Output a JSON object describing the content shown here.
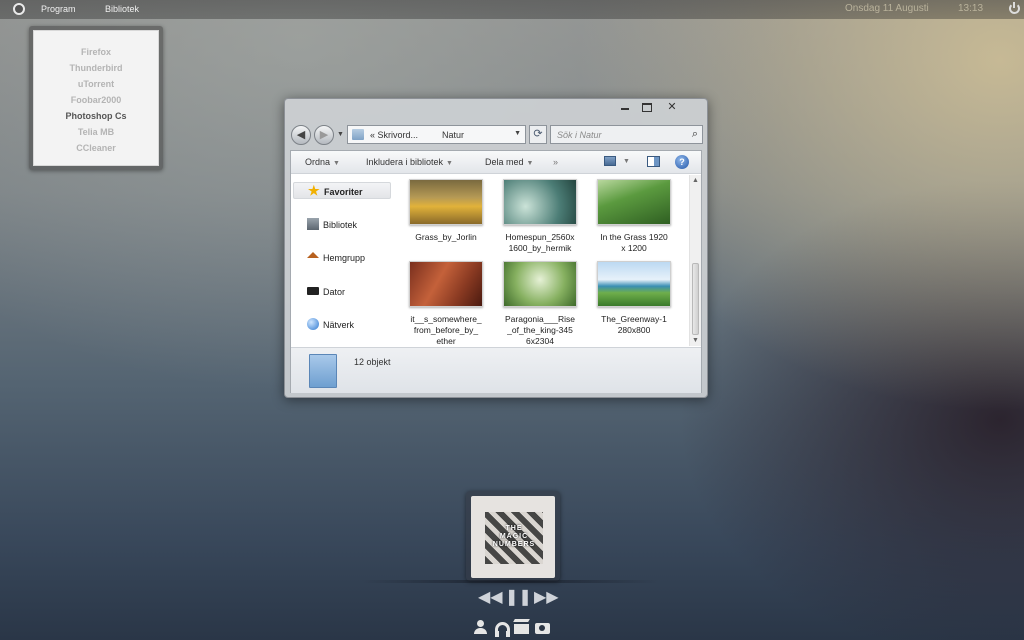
{
  "topbar": {
    "menu": [
      "Program",
      "Bibliotek"
    ],
    "date": "Onsdag 11 Augusti",
    "time": "13:13"
  },
  "launcher": {
    "items": [
      "Firefox",
      "Thunderbird",
      "uTorrent",
      "Foobar2000",
      "Photoshop Cs",
      "Telia MB",
      "CCleaner"
    ],
    "active_item": "Photoshop Cs"
  },
  "explorer": {
    "caption_buttons": {
      "minimize": "minimize-icon",
      "maximize": "maximize-icon",
      "close": "✕"
    },
    "address": {
      "crumbs": [
        "« Skrivord...",
        "Natur"
      ]
    },
    "search": {
      "placeholder": "Sök i Natur"
    },
    "commands": [
      "Ordna",
      "Inkludera i bibliotek",
      "Dela med",
      "»"
    ],
    "nav_pane": [
      {
        "label": "Favoriter",
        "icon": "star-icon"
      },
      {
        "label": "Bibliotek",
        "icon": "library-icon"
      },
      {
        "label": "Hemgrupp",
        "icon": "homegroup-icon"
      },
      {
        "label": "Dator",
        "icon": "computer-icon"
      },
      {
        "label": "Nätverk",
        "icon": "network-icon"
      }
    ],
    "files": [
      {
        "name": "Grass_by_Jorlin"
      },
      {
        "name": "Homespun_2560x\n1600_by_hermik"
      },
      {
        "name": "In the Grass 1920\nx 1200"
      },
      {
        "name": "it__s_somewhere_\nfrom_before_by_\nether"
      },
      {
        "name": "Paragonia___Rise\n_of_the_king-345\n6x2304"
      },
      {
        "name": "The_Greenway-1\n280x800"
      }
    ],
    "status": "12 objekt"
  },
  "player": {
    "album_art_text": "THE\nMAGIC\nNUMBERS",
    "controls": {
      "prev": "◀◀",
      "pause": "❚❚",
      "next": "▶▶"
    },
    "dock_icons": [
      "person-icon",
      "headphones-icon",
      "video-icon",
      "camera-icon"
    ]
  },
  "colors": {
    "accent": "#2f79d0",
    "favorites_star": "#f1b000"
  }
}
